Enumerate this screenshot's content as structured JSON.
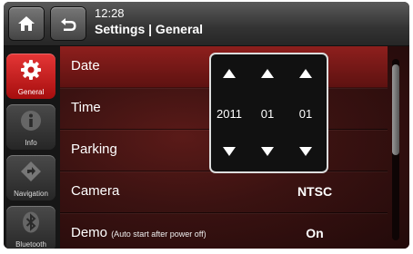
{
  "header": {
    "time": "12:28",
    "breadcrumb": "Settings | General",
    "home_icon": "home-icon",
    "back_icon": "back-icon"
  },
  "sidebar": {
    "items": [
      {
        "label": "General",
        "icon": "gear-icon",
        "active": true
      },
      {
        "label": "Info",
        "icon": "info-icon",
        "active": false
      },
      {
        "label": "Navigation",
        "icon": "navigation-icon",
        "active": false
      },
      {
        "label": "Bluetooth",
        "icon": "bluetooth-icon",
        "active": false
      }
    ]
  },
  "settings": {
    "rows": [
      {
        "label": "Date",
        "sub": "",
        "value": ""
      },
      {
        "label": "Time",
        "sub": "",
        "value": ""
      },
      {
        "label": "Parking",
        "sub": "",
        "value": ""
      },
      {
        "label": "Camera",
        "sub": "",
        "value": "NTSC"
      },
      {
        "label": "Demo",
        "sub": "(Auto start after power off)",
        "value": "On"
      }
    ]
  },
  "date_picker": {
    "year": "2011",
    "month": "01",
    "day": "01"
  },
  "colors": {
    "accent": "#d42a2a",
    "selected_row": "#8e1f1d"
  }
}
